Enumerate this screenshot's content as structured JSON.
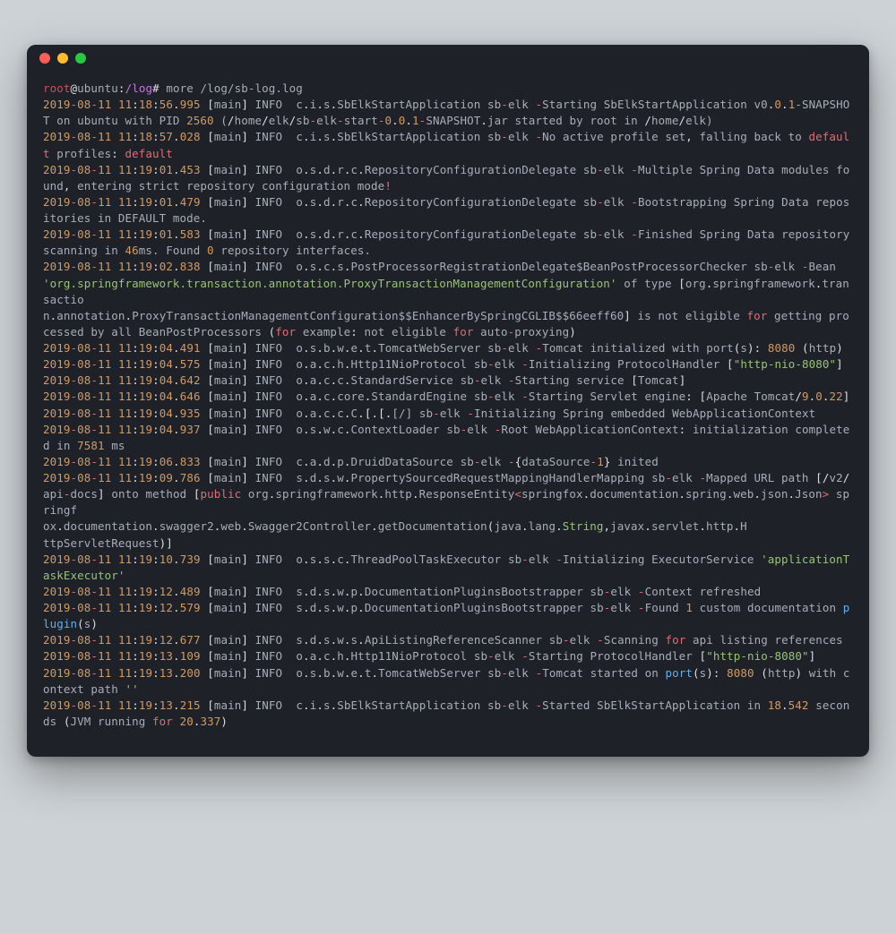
{
  "prompt": {
    "user": "root",
    "at": "@",
    "host": "ubuntu",
    "colon": ":",
    "path": "/log",
    "hash": "# ",
    "cmd": "more /log/sb-log.log"
  },
  "y": "2019",
  "m": "08",
  "d": "11",
  "log": [
    {
      "t": "11:18:56.995",
      "logger": "c.i.s.SbElkStartApplication sb-elk",
      "body": [
        {
          "txt": "Starting SbElkStartApplication v0"
        },
        {
          "txt": ".",
          "cls": "c-white"
        },
        {
          "txt": "0",
          "cls": "c-num"
        },
        {
          "txt": ".",
          "cls": "c-white"
        },
        {
          "txt": "1",
          "cls": "c-num"
        },
        {
          "txt": "-SNAPSHOT on ubuntu with PID ",
          "cls": "c-grey"
        },
        {
          "txt": "2560",
          "cls": "c-num"
        },
        {
          "txt": " (",
          "cls": "c-grey"
        },
        {
          "txt": "/",
          "cls": "c-white"
        },
        {
          "txt": "home",
          "cls": "c-grey"
        },
        {
          "txt": "/",
          "cls": "c-white"
        },
        {
          "txt": "elk",
          "cls": "c-grey"
        },
        {
          "txt": "/",
          "cls": "c-white"
        },
        {
          "txt": "sb",
          "cls": "c-grey"
        },
        {
          "txt": "-",
          "cls": "c-red"
        },
        {
          "txt": "elk",
          "cls": "c-grey"
        },
        {
          "txt": "-",
          "cls": "c-red"
        },
        {
          "txt": "start",
          "cls": "c-grey"
        },
        {
          "txt": "-",
          "cls": "c-red"
        },
        {
          "txt": "0",
          "cls": "c-num"
        },
        {
          "txt": ".",
          "cls": "c-white"
        },
        {
          "txt": "0",
          "cls": "c-num"
        },
        {
          "txt": ".",
          "cls": "c-white"
        },
        {
          "txt": "1",
          "cls": "c-num"
        },
        {
          "txt": "-",
          "cls": "c-red"
        },
        {
          "txt": "SNAPSHOT",
          "cls": "c-grey"
        },
        {
          "txt": ".",
          "cls": "c-white"
        },
        {
          "txt": "jar started by root in ",
          "cls": "c-grey"
        },
        {
          "txt": "/",
          "cls": "c-white"
        },
        {
          "txt": "home",
          "cls": "c-grey"
        },
        {
          "txt": "/",
          "cls": "c-white"
        },
        {
          "txt": "elk",
          "cls": "c-grey"
        },
        {
          "txt": ")",
          "cls": "c-grey"
        }
      ]
    },
    {
      "t": "11:18:57.028",
      "logger": "c.i.s.SbElkStartApplication sb-elk",
      "body": [
        {
          "txt": "No active profile set"
        },
        {
          "txt": ", ",
          "cls": "c-white"
        },
        {
          "txt": "falling back to ",
          "cls": "c-grey"
        },
        {
          "txt": "default",
          "cls": "c-red"
        },
        {
          "txt": " profiles",
          "cls": "c-grey"
        },
        {
          "txt": ": ",
          "cls": "c-white"
        },
        {
          "txt": "default",
          "cls": "c-red"
        }
      ]
    },
    {
      "t": "11:19:01.453",
      "logger": "o.s.d.r.c.RepositoryConfigurationDelegate sb-elk",
      "body": [
        {
          "txt": "Multiple Spring Data modules found"
        },
        {
          "txt": ", ",
          "cls": "c-white"
        },
        {
          "txt": "entering strict repository configuration mode",
          "cls": "c-grey"
        },
        {
          "txt": "!",
          "cls": "c-red"
        }
      ]
    },
    {
      "t": "11:19:01.479",
      "logger": "o.s.d.r.c.RepositoryConfigurationDelegate sb-elk",
      "body": [
        {
          "txt": "Bootstrapping Spring Data repositories in DEFAULT mode."
        }
      ]
    },
    {
      "t": "11:19:01.583",
      "logger": "o.s.d.r.c.RepositoryConfigurationDelegate sb-elk",
      "body": [
        {
          "txt": "Finished Spring Data repository scanning in "
        },
        {
          "txt": "46",
          "cls": "c-num"
        },
        {
          "txt": "ms. Found ",
          "cls": "c-grey"
        },
        {
          "txt": "0",
          "cls": "c-num"
        },
        {
          "txt": " repository interfaces.",
          "cls": "c-grey"
        }
      ]
    },
    {
      "t": "11:19:02.838",
      "logger": "o.s.c.s.PostProcessorRegistrationDelegate$BeanPostProcessorChecker sb-elk",
      "body": [
        {
          "txt": "Bean "
        },
        {
          "txt": "'org.springframework.transaction.annotation.ProxyTransactionManagementConfiguration'",
          "cls": "c-green"
        },
        {
          "txt": " of type ",
          "cls": "c-grey"
        },
        {
          "txt": "[",
          "cls": "c-white"
        },
        {
          "txt": "org",
          "cls": "c-grey"
        },
        {
          "txt": ".",
          "cls": "c-white"
        },
        {
          "txt": "springframework",
          "cls": "c-grey"
        },
        {
          "txt": ".",
          "cls": "c-white"
        },
        {
          "txt": "transactio\nn",
          "cls": "c-grey"
        },
        {
          "txt": ".",
          "cls": "c-white"
        },
        {
          "txt": "annotation",
          "cls": "c-grey"
        },
        {
          "txt": ".",
          "cls": "c-white"
        },
        {
          "txt": "ProxyTransactionManagementConfiguration$$EnhancerBySpringCGLIB$$66eeff60",
          "cls": "c-grey"
        },
        {
          "txt": "]",
          "cls": "c-white"
        },
        {
          "txt": " is not eligible ",
          "cls": "c-grey"
        },
        {
          "txt": "for",
          "cls": "c-red"
        },
        {
          "txt": " getting processed by all BeanPostProcessors ",
          "cls": "c-grey"
        },
        {
          "txt": "(",
          "cls": "c-white"
        },
        {
          "txt": "for",
          "cls": "c-red"
        },
        {
          "txt": " example",
          "cls": "c-grey"
        },
        {
          "txt": ": ",
          "cls": "c-white"
        },
        {
          "txt": "not eligible ",
          "cls": "c-grey"
        },
        {
          "txt": "for",
          "cls": "c-red"
        },
        {
          "txt": " auto",
          "cls": "c-grey"
        },
        {
          "txt": "-",
          "cls": "c-red"
        },
        {
          "txt": "proxying",
          "cls": "c-grey"
        },
        {
          "txt": ")",
          "cls": "c-white"
        }
      ]
    },
    {
      "t": "11:19:04.491",
      "logger": "o.s.b.w.e.t.TomcatWebServer sb-elk",
      "body": [
        {
          "txt": "Tomcat initialized with port"
        },
        {
          "txt": "(",
          "cls": "c-white"
        },
        {
          "txt": "s",
          "cls": "c-grey"
        },
        {
          "txt": "): ",
          "cls": "c-white"
        },
        {
          "txt": "8080",
          "cls": "c-num"
        },
        {
          "txt": " (",
          "cls": "c-white"
        },
        {
          "txt": "http",
          "cls": "c-grey"
        },
        {
          "txt": ")",
          "cls": "c-white"
        }
      ]
    },
    {
      "t": "11:19:04.575",
      "logger": "o.a.c.h.Http11NioProtocol sb-elk",
      "body": [
        {
          "txt": "Initializing ProtocolHandler "
        },
        {
          "txt": "[",
          "cls": "c-white"
        },
        {
          "txt": "\"http-nio-8080\"",
          "cls": "c-green"
        },
        {
          "txt": "]",
          "cls": "c-white"
        }
      ]
    },
    {
      "t": "11:19:04.642",
      "logger": "o.a.c.c.StandardService sb-elk",
      "body": [
        {
          "txt": "Starting service "
        },
        {
          "txt": "[",
          "cls": "c-white"
        },
        {
          "txt": "Tomcat",
          "cls": "c-grey"
        },
        {
          "txt": "]",
          "cls": "c-white"
        }
      ]
    },
    {
      "t": "11:19:04.646",
      "logger": "o.a.c.core.StandardEngine sb-elk",
      "body": [
        {
          "txt": "Starting Servlet engine"
        },
        {
          "txt": ": ",
          "cls": "c-white"
        },
        {
          "txt": "[",
          "cls": "c-white"
        },
        {
          "txt": "Apache Tomcat",
          "cls": "c-grey"
        },
        {
          "txt": "/",
          "cls": "c-white"
        },
        {
          "txt": "9",
          "cls": "c-num"
        },
        {
          "txt": ".",
          "cls": "c-white"
        },
        {
          "txt": "0",
          "cls": "c-num"
        },
        {
          "txt": ".",
          "cls": "c-white"
        },
        {
          "txt": "22",
          "cls": "c-num"
        },
        {
          "txt": "]",
          "cls": "c-white"
        }
      ]
    },
    {
      "t": "11:19:04.935",
      "logger": "o.a.c.c.C.[.[.[/] sb-elk",
      "body": [
        {
          "txt": "Initializing Spring embedded WebApplicationContext"
        }
      ]
    },
    {
      "t": "11:19:04.937",
      "logger": "o.s.w.c.ContextLoader sb-elk",
      "body": [
        {
          "txt": "Root WebApplicationContext"
        },
        {
          "txt": ": ",
          "cls": "c-white"
        },
        {
          "txt": "initialization completed in ",
          "cls": "c-grey"
        },
        {
          "txt": "7581",
          "cls": "c-num"
        },
        {
          "txt": " ms",
          "cls": "c-grey"
        }
      ]
    },
    {
      "t": "11:19:06.833",
      "logger": "c.a.d.p.DruidDataSource sb-elk",
      "body": [
        {
          "txt": "{",
          "cls": "c-white"
        },
        {
          "txt": "dataSource",
          "cls": "c-grey"
        },
        {
          "txt": "-",
          "cls": "c-red"
        },
        {
          "txt": "1",
          "cls": "c-num"
        },
        {
          "txt": "}",
          "cls": "c-white"
        },
        {
          "txt": " inited",
          "cls": "c-grey"
        }
      ]
    },
    {
      "t": "11:19:09.786",
      "logger": "s.d.s.w.PropertySourcedRequestMappingHandlerMapping sb-elk",
      "body": [
        {
          "txt": "Mapped URL path "
        },
        {
          "txt": "[",
          "cls": "c-white"
        },
        {
          "txt": "/",
          "cls": "c-white"
        },
        {
          "txt": "v2",
          "cls": "c-grey"
        },
        {
          "txt": "/",
          "cls": "c-white"
        },
        {
          "txt": "api",
          "cls": "c-grey"
        },
        {
          "txt": "-",
          "cls": "c-red"
        },
        {
          "txt": "docs",
          "cls": "c-grey"
        },
        {
          "txt": "]",
          "cls": "c-white"
        },
        {
          "txt": " onto method ",
          "cls": "c-grey"
        },
        {
          "txt": "[",
          "cls": "c-white"
        },
        {
          "txt": "public",
          "cls": "c-red"
        },
        {
          "txt": " org",
          "cls": "c-grey"
        },
        {
          "txt": ".",
          "cls": "c-white"
        },
        {
          "txt": "springframework",
          "cls": "c-grey"
        },
        {
          "txt": ".",
          "cls": "c-white"
        },
        {
          "txt": "http",
          "cls": "c-grey"
        },
        {
          "txt": ".",
          "cls": "c-white"
        },
        {
          "txt": "ResponseEntity",
          "cls": "c-grey"
        },
        {
          "txt": "<",
          "cls": "c-red"
        },
        {
          "txt": "springfox",
          "cls": "c-grey"
        },
        {
          "txt": ".",
          "cls": "c-white"
        },
        {
          "txt": "documentation",
          "cls": "c-grey"
        },
        {
          "txt": ".",
          "cls": "c-white"
        },
        {
          "txt": "spring",
          "cls": "c-grey"
        },
        {
          "txt": ".",
          "cls": "c-white"
        },
        {
          "txt": "web",
          "cls": "c-grey"
        },
        {
          "txt": ".",
          "cls": "c-white"
        },
        {
          "txt": "json",
          "cls": "c-grey"
        },
        {
          "txt": ".",
          "cls": "c-white"
        },
        {
          "txt": "Json",
          "cls": "c-grey"
        },
        {
          "txt": ">",
          "cls": "c-red"
        },
        {
          "txt": " springf\nox",
          "cls": "c-grey"
        },
        {
          "txt": ".",
          "cls": "c-white"
        },
        {
          "txt": "documentation",
          "cls": "c-grey"
        },
        {
          "txt": ".",
          "cls": "c-white"
        },
        {
          "txt": "swagger2",
          "cls": "c-grey"
        },
        {
          "txt": ".",
          "cls": "c-white"
        },
        {
          "txt": "web",
          "cls": "c-grey"
        },
        {
          "txt": ".",
          "cls": "c-white"
        },
        {
          "txt": "Swagger2Controller",
          "cls": "c-grey"
        },
        {
          "txt": ".",
          "cls": "c-white"
        },
        {
          "txt": "getDocumentation",
          "cls": "c-grey"
        },
        {
          "txt": "(",
          "cls": "c-white"
        },
        {
          "txt": "java",
          "cls": "c-grey"
        },
        {
          "txt": ".",
          "cls": "c-white"
        },
        {
          "txt": "lang",
          "cls": "c-grey"
        },
        {
          "txt": ".",
          "cls": "c-white"
        },
        {
          "txt": "String",
          "cls": "c-green"
        },
        {
          "txt": ",",
          "cls": "c-white"
        },
        {
          "txt": "javax",
          "cls": "c-grey"
        },
        {
          "txt": ".",
          "cls": "c-white"
        },
        {
          "txt": "servlet",
          "cls": "c-grey"
        },
        {
          "txt": ".",
          "cls": "c-white"
        },
        {
          "txt": "http",
          "cls": "c-grey"
        },
        {
          "txt": ".",
          "cls": "c-white"
        },
        {
          "txt": "H\nttpServletRequest",
          "cls": "c-grey"
        },
        {
          "txt": ")]",
          "cls": "c-white"
        }
      ]
    },
    {
      "t": "11:19:10.739",
      "logger": "o.s.s.c.ThreadPoolTaskExecutor sb-elk",
      "body": [
        {
          "txt": "Initializing ExecutorService "
        },
        {
          "txt": "'applicationTaskExecutor'",
          "cls": "c-green"
        }
      ]
    },
    {
      "t": "11:19:12.489",
      "logger": "s.d.s.w.p.DocumentationPluginsBootstrapper sb-elk",
      "body": [
        {
          "txt": "Context refreshed"
        }
      ]
    },
    {
      "t": "11:19:12.579",
      "logger": "s.d.s.w.p.DocumentationPluginsBootstrapper sb-elk",
      "body": [
        {
          "txt": "Found "
        },
        {
          "txt": "1",
          "cls": "c-num"
        },
        {
          "txt": " custom documentation ",
          "cls": "c-grey"
        },
        {
          "txt": "plugin",
          "cls": "c-blue"
        },
        {
          "txt": "(",
          "cls": "c-white"
        },
        {
          "txt": "s",
          "cls": "c-grey"
        },
        {
          "txt": ")",
          "cls": "c-white"
        }
      ]
    },
    {
      "t": "11:19:12.677",
      "logger": "s.d.s.w.s.ApiListingReferenceScanner sb-elk",
      "body": [
        {
          "txt": "Scanning "
        },
        {
          "txt": "for",
          "cls": "c-red"
        },
        {
          "txt": " api listing references",
          "cls": "c-grey"
        }
      ]
    },
    {
      "t": "11:19:13.109",
      "logger": "o.a.c.h.Http11NioProtocol sb-elk",
      "body": [
        {
          "txt": "Starting ProtocolHandler "
        },
        {
          "txt": "[",
          "cls": "c-white"
        },
        {
          "txt": "\"http-nio-8080\"",
          "cls": "c-green"
        },
        {
          "txt": "]",
          "cls": "c-white"
        }
      ]
    },
    {
      "t": "11:19:13.200",
      "logger": "o.s.b.w.e.t.TomcatWebServer sb-elk",
      "body": [
        {
          "txt": "Tomcat started on "
        },
        {
          "txt": "port",
          "cls": "c-blue"
        },
        {
          "txt": "(",
          "cls": "c-white"
        },
        {
          "txt": "s",
          "cls": "c-grey"
        },
        {
          "txt": "): ",
          "cls": "c-white"
        },
        {
          "txt": "8080",
          "cls": "c-num"
        },
        {
          "txt": " (",
          "cls": "c-white"
        },
        {
          "txt": "http",
          "cls": "c-grey"
        },
        {
          "txt": ")",
          "cls": "c-white"
        },
        {
          "txt": " with context path ",
          "cls": "c-grey"
        },
        {
          "txt": "''",
          "cls": "c-green"
        }
      ]
    },
    {
      "t": "11:19:13.215",
      "logger": "c.i.s.SbElkStartApplication sb-elk",
      "body": [
        {
          "txt": "Started SbElkStartApplication in "
        },
        {
          "txt": "18",
          "cls": "c-num"
        },
        {
          "txt": ".",
          "cls": "c-white"
        },
        {
          "txt": "542",
          "cls": "c-num"
        },
        {
          "txt": " seconds ",
          "cls": "c-grey"
        },
        {
          "txt": "(",
          "cls": "c-white"
        },
        {
          "txt": "JVM running ",
          "cls": "c-grey"
        },
        {
          "txt": "for",
          "cls": "c-red"
        },
        {
          "txt": " ",
          "cls": "c-grey"
        },
        {
          "txt": "20",
          "cls": "c-num"
        },
        {
          "txt": ".",
          "cls": "c-white"
        },
        {
          "txt": "337",
          "cls": "c-num"
        },
        {
          "txt": ")",
          "cls": "c-white"
        }
      ]
    }
  ]
}
